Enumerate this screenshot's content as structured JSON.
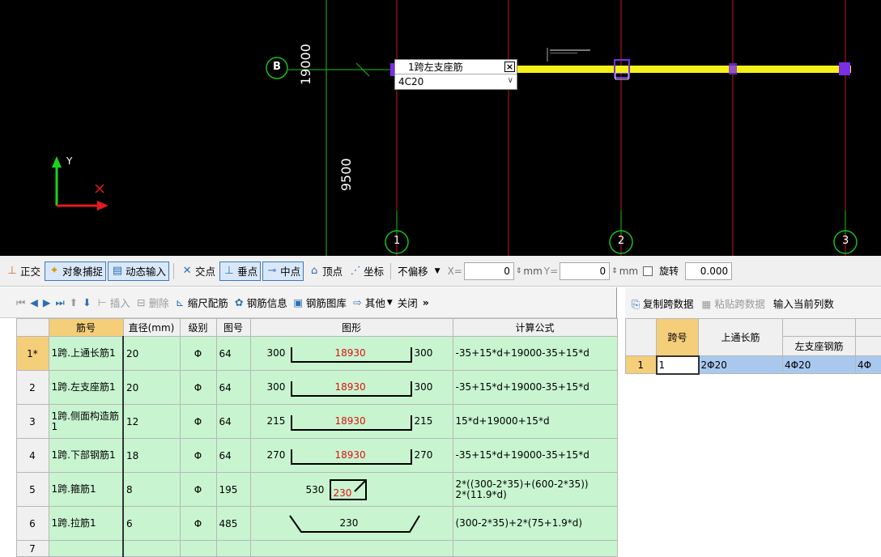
{
  "canvas": {
    "axis_b": "B",
    "dim_top": "19000",
    "dim_mid": "9500",
    "axis_1": "1",
    "axis_2": "2",
    "axis_3": "3",
    "coord_y": "Y",
    "picker_title": "1跨左支座筋",
    "picker_value": "4C20"
  },
  "toolbar": {
    "zhengjiao": "正交",
    "snap": "对象捕捉",
    "dynamic": "动态输入",
    "intersect": "交点",
    "perp": "垂点",
    "mid": "中点",
    "vertex": "顶点",
    "coord": "坐标",
    "offset": "不偏移",
    "x_label": "X=",
    "x_value": "0",
    "mm1": "mm",
    "y_label": "Y=",
    "y_value": "0",
    "mm2": "mm",
    "rotate": "旋转",
    "rotate_value": "0.000"
  },
  "left_tools": {
    "insert": "插入",
    "delete": "删除",
    "scale": "缩尺配筋",
    "info": "钢筋信息",
    "lib": "钢筋图库",
    "other": "其他",
    "close": "关闭"
  },
  "grid": {
    "headers": [
      "筋号",
      "直径(mm)",
      "级别",
      "图号",
      "图形",
      "计算公式"
    ],
    "rows": [
      {
        "idx": "1*",
        "name": "1跨.上通长筋1",
        "dia": "20",
        "grade": "Φ",
        "fig": "64",
        "left": "300",
        "mid": "18930",
        "right": "300",
        "formula": "-35+15*d+19000-35+15*d"
      },
      {
        "idx": "2",
        "name": "1跨.左支座筋1",
        "dia": "20",
        "grade": "Φ",
        "fig": "64",
        "left": "300",
        "mid": "18930",
        "right": "300",
        "formula": "-35+15*d+19000-35+15*d"
      },
      {
        "idx": "3",
        "name": "1跨.侧面构造筋1",
        "dia": "12",
        "grade": "Φ",
        "fig": "64",
        "left": "215",
        "mid": "18930",
        "right": "215",
        "formula": "15*d+19000+15*d"
      },
      {
        "idx": "4",
        "name": "1跨.下部钢筋1",
        "dia": "18",
        "grade": "Φ",
        "fig": "64",
        "left": "270",
        "mid": "18930",
        "right": "270",
        "formula": "-35+15*d+19000-35+15*d"
      },
      {
        "idx": "5",
        "name": "1跨.箍筋1",
        "dia": "8",
        "grade": "Φ",
        "fig": "195",
        "left": "530",
        "mid": "230",
        "right": "",
        "formula": "2*((300-2*35)+(600-2*35))",
        "formula2": "2*(11.9*d)"
      },
      {
        "idx": "6",
        "name": "1跨.拉筋1",
        "dia": "6",
        "grade": "Φ",
        "fig": "485",
        "left": "",
        "mid": "230",
        "right": "",
        "formula": "(300-2*35)+2*(75+1.9*d)"
      },
      {
        "idx": "7",
        "name": "",
        "dia": "",
        "grade": "",
        "fig": "",
        "left": "",
        "mid": "",
        "right": "",
        "formula": ""
      }
    ]
  },
  "right_tools": {
    "copy": "复制跨数据",
    "paste": "粘贴跨数据",
    "input": "输入当前列数"
  },
  "rgrid": {
    "h_span": "跨号",
    "h_top": "上通长筋",
    "h_left": "左支座钢筋",
    "row_idx": "1",
    "row_span": "1",
    "row_top": "2Φ20",
    "row_left": "4Φ20",
    "row_more": "4Φ"
  }
}
